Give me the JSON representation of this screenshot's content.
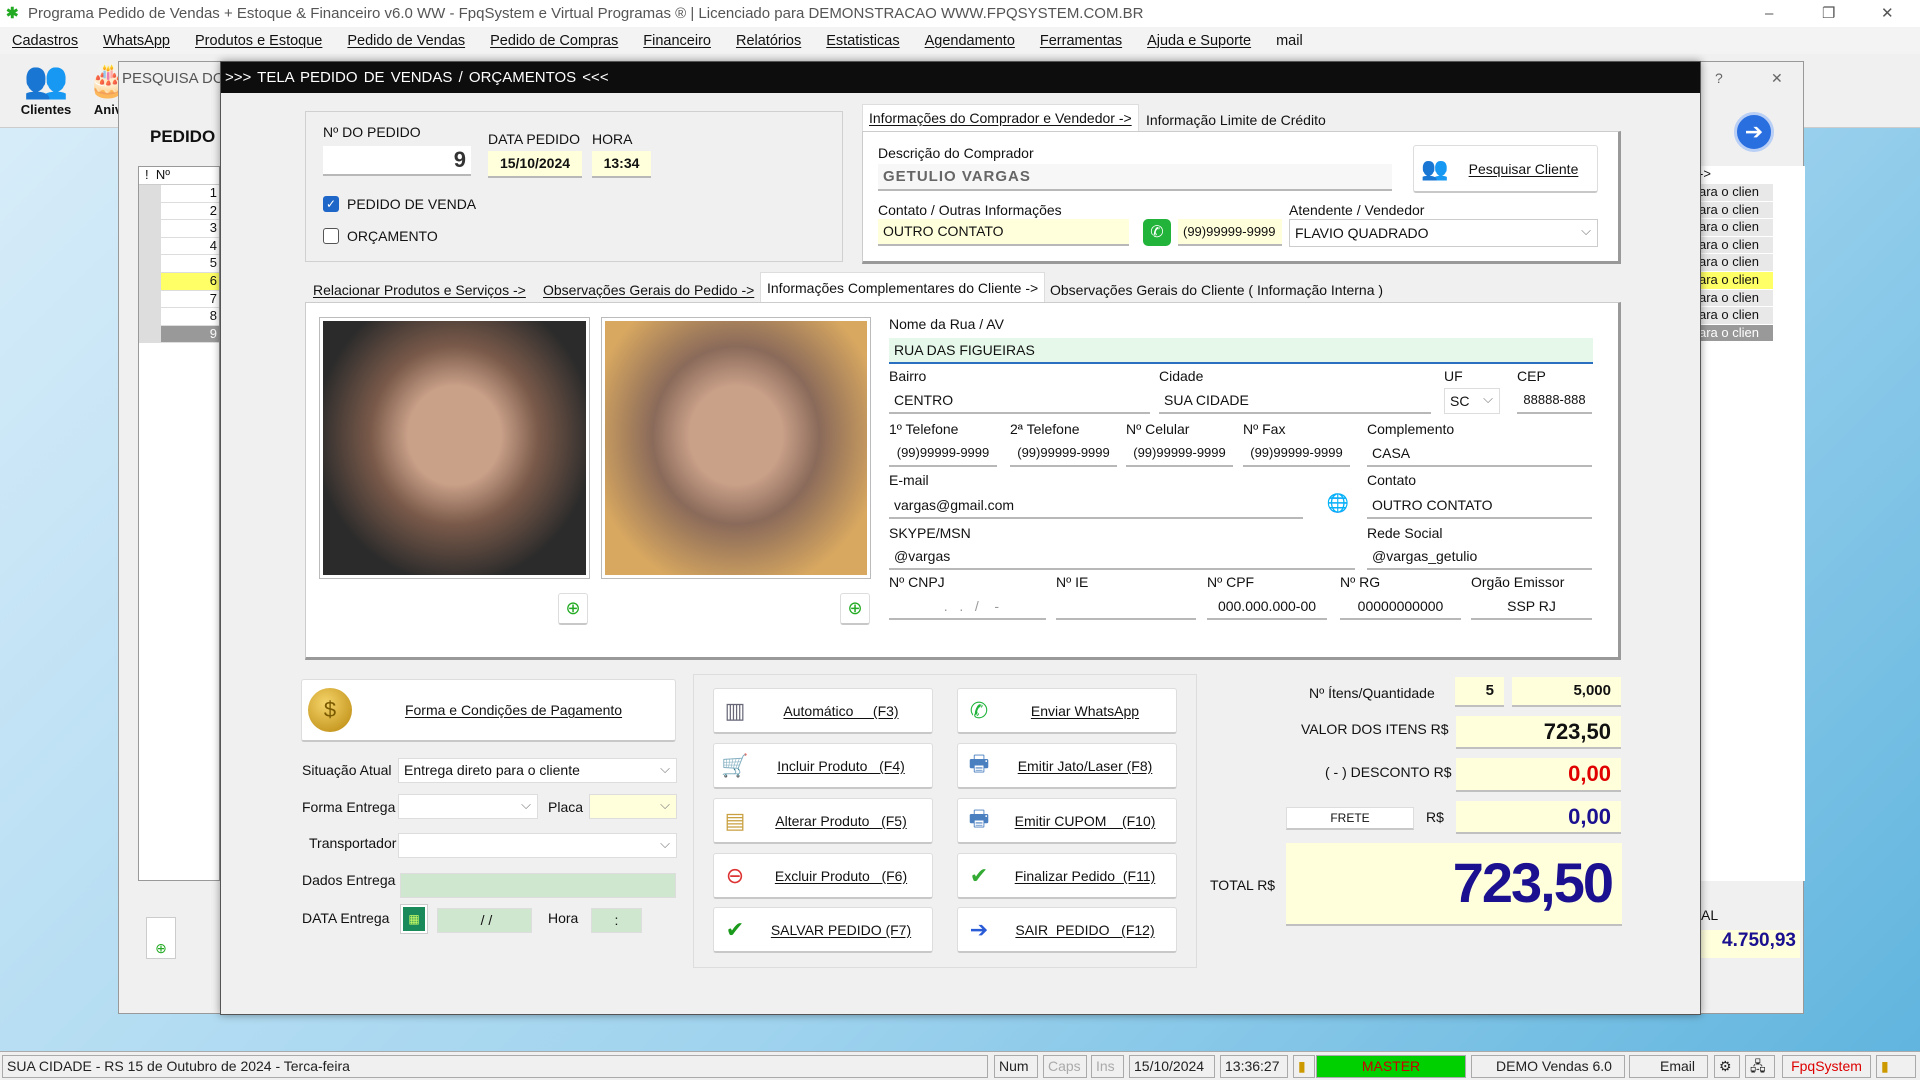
{
  "window": {
    "title": "Programa Pedido de Vendas + Estoque & Financeiro v6.0 WW - FpqSystem e Virtual Programas ® | Licenciado para  DEMONSTRACAO WWW.FPQSYSTEM.COM.BR",
    "min": "–",
    "max": "❐",
    "close": "✕"
  },
  "menu": [
    "Cadastros",
    "WhatsApp",
    "Produtos e Estoque",
    "Pedido de Vendas",
    "Pedido de Compras",
    "Financeiro",
    "Relatórios",
    "Estatisticas",
    "Agendamento",
    "Ferramentas",
    "Ajuda e Suporte",
    "mail"
  ],
  "toolbar": {
    "clientes": "Clientes",
    "aniv": "Aniv"
  },
  "bg": {
    "title": "PESQUISA DOS",
    "help": "?",
    "close": "✕",
    "heading": "PEDIDO D",
    "grid_header": [
      "!",
      "Nº"
    ],
    "rows": [
      "1",
      "2",
      "3",
      "4",
      "5",
      "6",
      "7",
      "8",
      "9"
    ],
    "right_header": "->",
    "right_cell": "ara o clien",
    "total_label": "AL",
    "total_value": "4.750,93"
  },
  "modal": {
    "title": ">>>  TELA PEDIDO DE VENDAS / ORÇAMENTOS  <<<",
    "order": {
      "number_label": "Nº DO PEDIDO",
      "number": "9",
      "date_label": "DATA PEDIDO",
      "date": "15/10/2024",
      "time_label": "HORA",
      "time": "13:34",
      "chk_venda": "PEDIDO DE VENDA",
      "chk_venda_checked": true,
      "chk_orc": "ORÇAMENTO",
      "chk_orc_checked": false
    },
    "buyer_tabs": [
      "Informações do Comprador e Vendedor ->",
      "Informação Limite de Crédito"
    ],
    "buyer": {
      "desc_label": "Descrição do Comprador",
      "desc": "GETULIO VARGAS",
      "search_btn": "Pesquisar Cliente",
      "contact_label": "Contato / Outras Informações",
      "contact": "OUTRO CONTATO",
      "phone": "(99)99999-9999",
      "seller_label": "Atendente / Vendedor",
      "seller": "FLAVIO QUADRADO"
    },
    "tabs": [
      "Relacionar Produtos e Serviços ->",
      "Observações Gerais do Pedido ->",
      "Informações Complementares do Cliente ->",
      "Observações Gerais do Cliente ( Informação Interna )"
    ],
    "active_tab": 2,
    "address": {
      "street_label": "Nome da Rua / AV",
      "street": "RUA DAS FIGUEIRAS",
      "bairro_label": "Bairro",
      "bairro": "CENTRO",
      "cidade_label": "Cidade",
      "cidade": "SUA CIDADE",
      "uf_label": "UF",
      "uf": "SC",
      "cep_label": "CEP",
      "cep": "88888-888",
      "tel1_label": "1º Telefone",
      "tel1": "(99)99999-9999",
      "tel2_label": "2ª Telefone",
      "tel2": "(99)99999-9999",
      "cel_label": "Nº Celular",
      "cel": "(99)99999-9999",
      "fax_label": "Nº Fax",
      "fax": "(99)99999-9999",
      "compl_label": "Complemento",
      "compl": "CASA",
      "email_label": "E-mail",
      "email": "vargas@gmail.com",
      "contato_label": "Contato",
      "contato": "OUTRO CONTATO",
      "skype_label": "SKYPE/MSN",
      "skype": "@vargas",
      "rede_label": "Rede Social",
      "rede": "@vargas_getulio",
      "cnpj_label": "Nº CNPJ",
      "cnpj": "  .   .   /    -",
      "ie_label": "Nº IE",
      "ie": "",
      "cpf_label": "Nº CPF",
      "cpf": "000.000.000-00",
      "rg_label": "Nº RG",
      "rg": "00000000000",
      "orgao_label": "Orgão Emissor",
      "orgao": "SSP RJ"
    },
    "payment_btn": "Forma e Condições de Pagamento",
    "delivery": {
      "situacao_label": "Situação Atual",
      "situacao": "Entrega direto para o cliente",
      "forma_label": "Forma Entrega",
      "forma": "",
      "placa_label": "Placa",
      "placa": "",
      "transp_label": "Transportador",
      "transp": "",
      "dados_label": "Dados Entrega",
      "dados": "",
      "data_label": "DATA Entrega",
      "data": " / /",
      "hora_label": "Hora",
      "hora": ":"
    },
    "actions": [
      {
        "label": "Automático     (F3)",
        "icon": "barcode-icon",
        "glyph": "▥",
        "color": "#667"
      },
      {
        "label": "Enviar WhatsApp",
        "icon": "whatsapp-icon",
        "glyph": "✆",
        "color": "#1fb33a"
      },
      {
        "label": "Incluir Produto   (F4)",
        "icon": "cart-icon",
        "glyph": "🛒",
        "color": "#b33"
      },
      {
        "label": "Emitir Jato/Laser (F8)",
        "icon": "printer-icon",
        "glyph": "🖶",
        "color": "#4a7fc0"
      },
      {
        "label": "Alterar Produto   (F5)",
        "icon": "table-edit-icon",
        "glyph": "▤",
        "color": "#c9a040"
      },
      {
        "label": "Emitir CUPOM    (F10)",
        "icon": "printer-icon",
        "glyph": "🖶",
        "color": "#4a7fc0"
      },
      {
        "label": "Excluir Produto   (F6)",
        "icon": "table-delete-icon",
        "glyph": "⊖",
        "color": "#d33"
      },
      {
        "label": "Finalizar Pedido  (F11)",
        "icon": "document-check-icon",
        "glyph": "✔",
        "color": "#3a3"
      },
      {
        "label": "SALVAR PEDIDO (F7)",
        "icon": "checkmark-icon",
        "glyph": "✔",
        "color": "#1a9a1a"
      },
      {
        "label": "SAIR  PEDIDO   (F12)",
        "icon": "exit-arrow-icon",
        "glyph": "➔",
        "color": "#2a5bd7"
      }
    ],
    "totals": {
      "items_label": "Nº Ítens/Quantidade",
      "items": "5",
      "qty": "5,000",
      "valor_label": "VALOR DOS ITENS R$",
      "valor": "723,50",
      "desc_label": "( - ) DESCONTO R$",
      "desc": "0,00",
      "frete_btn": "FRETE",
      "frete_label": "R$",
      "frete": "0,00",
      "total_label": "TOTAL R$",
      "total": "723,50"
    },
    "colors": {
      "discount": "#e00000",
      "blue_value": "#1a1090",
      "master_green": "#00d000"
    }
  },
  "status": {
    "location": "SUA CIDADE - RS 15 de Outubro de 2024 - Terca-feira",
    "num": "Num",
    "caps": "Caps",
    "ins": "Ins",
    "date": "15/10/2024",
    "time": "13:36:27",
    "user": "MASTER",
    "version": "DEMO Vendas 6.0",
    "email": "Email",
    "brand": "FpqSystem"
  }
}
